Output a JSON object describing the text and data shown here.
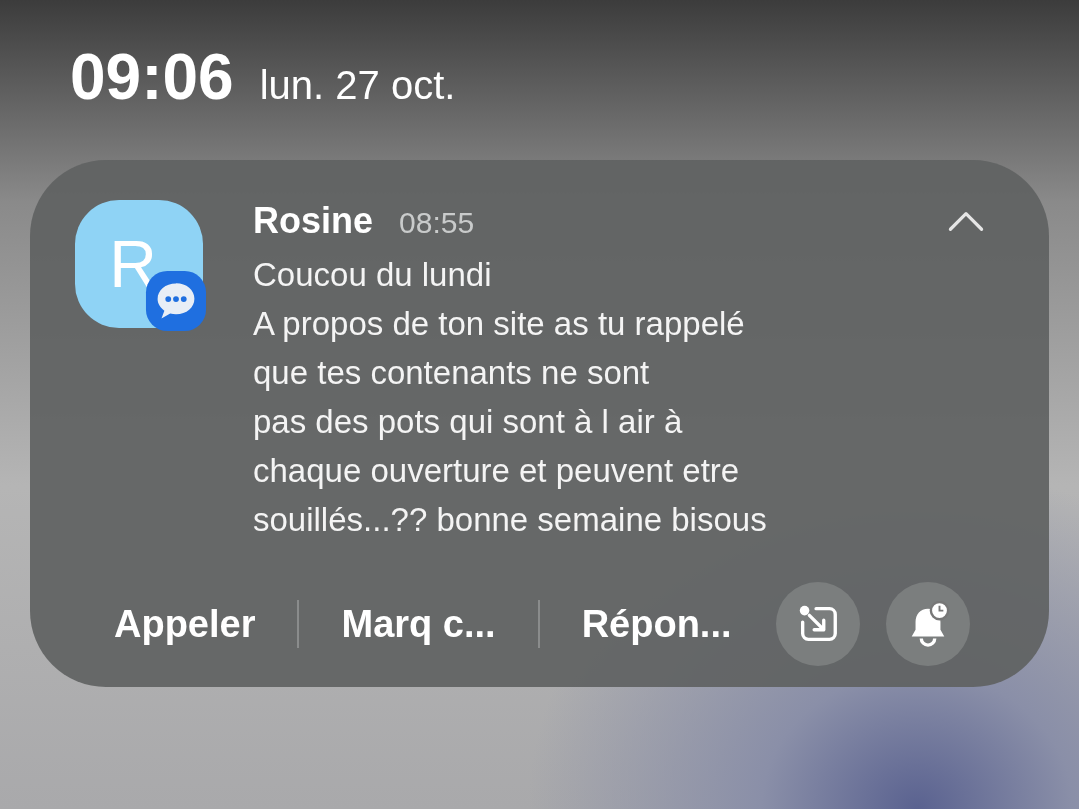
{
  "clock": {
    "time": "09:06",
    "date": "lun. 27 oct."
  },
  "notification": {
    "avatar_letter": "R",
    "sender": "Rosine",
    "time": "08:55",
    "expanded": true,
    "lines": [
      "Coucou du lundi",
      "A propos de ton site as tu rappelé",
      "que tes contenants ne sont",
      "pas des pots qui sont à l air à",
      "chaque ouverture et peuvent etre",
      "souillés...?? bonne semaine bisous"
    ],
    "actions": [
      "Appeler",
      "Marq c...",
      "Répon..."
    ]
  }
}
